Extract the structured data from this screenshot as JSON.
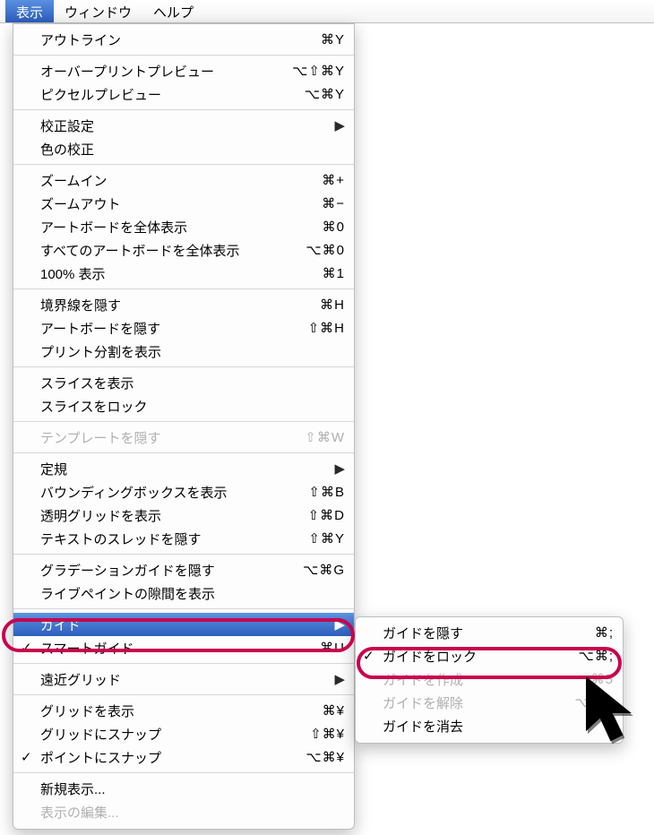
{
  "menubar": {
    "view": "表示",
    "window": "ウィンドウ",
    "help": "ヘルプ"
  },
  "menu": {
    "outline": "アウトライン",
    "outline_sc": "⌘Y",
    "overprint": "オーバープリントプレビュー",
    "overprint_sc": "⌥⇧⌘Y",
    "pixel": "ピクセルプレビュー",
    "pixel_sc": "⌥⌘Y",
    "proofsetup": "校正設定",
    "proofcolor": "色の校正",
    "zoomin": "ズームイン",
    "zoomin_sc": "⌘+",
    "zoomout": "ズームアウト",
    "zoomout_sc": "⌘−",
    "fitab": "アートボードを全体表示",
    "fitab_sc": "⌘0",
    "fitall": "すべてのアートボードを全体表示",
    "fitall_sc": "⌥⌘0",
    "actual": "100% 表示",
    "actual_sc": "⌘1",
    "hideedge": "境界線を隠す",
    "hideedge_sc": "⌘H",
    "hideab": "アートボードを隠す",
    "hideab_sc": "⇧⌘H",
    "showpt": "プリント分割を表示",
    "showslice": "スライスを表示",
    "lockslice": "スライスをロック",
    "hidetmpl": "テンプレートを隠す",
    "hidetmpl_sc": "⇧⌘W",
    "rulers": "定規",
    "showbb": "バウンディングボックスを表示",
    "showbb_sc": "⇧⌘B",
    "showtg": "透明グリッドを表示",
    "showtg_sc": "⇧⌘D",
    "hidett": "テキストのスレッドを隠す",
    "hidett_sc": "⇧⌘Y",
    "hidegg": "グラデーションガイドを隠す",
    "hidegg_sc": "⌥⌘G",
    "showlp": "ライブペイントの隙間を表示",
    "guides": "ガイド",
    "smart": "スマートガイド",
    "smart_sc": "⌘U",
    "persp": "遠近グリッド",
    "showgrid": "グリッドを表示",
    "showgrid_sc": "⌘¥",
    "snapgrid": "グリッドにスナップ",
    "snapgrid_sc": "⇧⌘¥",
    "snappt": "ポイントにスナップ",
    "snappt_sc": "⌥⌘¥",
    "newview": "新規表示...",
    "editview": "表示の編集..."
  },
  "submenu": {
    "hideg": "ガイドを隠す",
    "hideg_sc": "⌘;",
    "lockg": "ガイドをロック",
    "lockg_sc": "⌥⌘;",
    "makeg": "ガイドを作成",
    "makeg_sc": "⌘5",
    "releaseg": "ガイドを解除",
    "releaseg_sc": "⌥⌘5",
    "clearg": "ガイドを消去"
  },
  "glyph": {
    "check": "✓",
    "arrow": "▶"
  }
}
